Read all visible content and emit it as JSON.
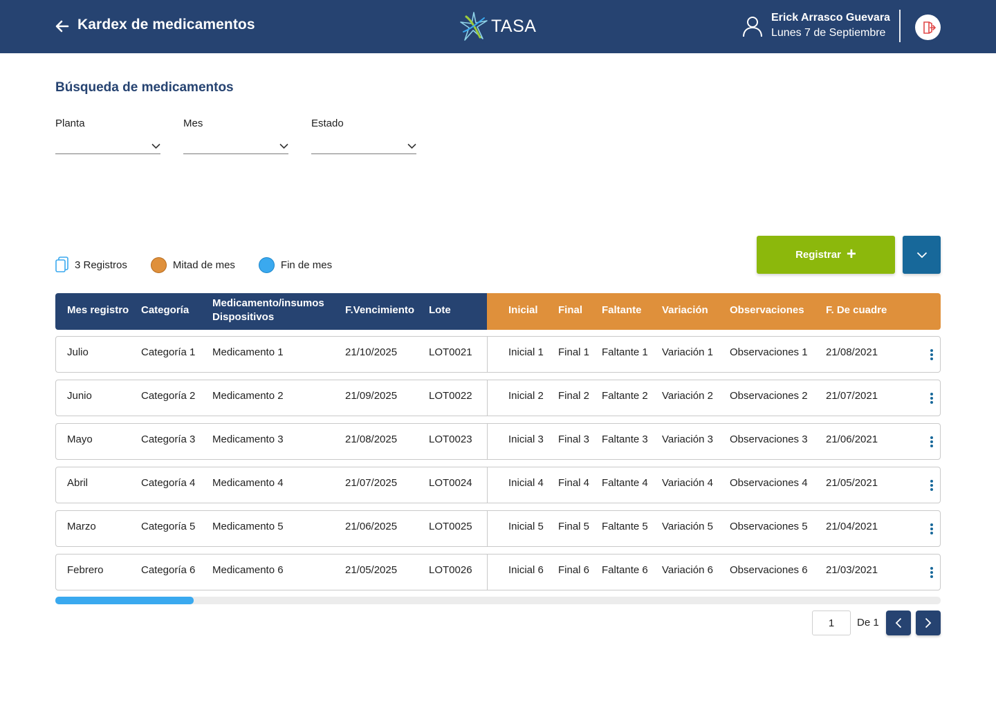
{
  "header": {
    "title": "Kardex de medicamentos",
    "brand": "TASA",
    "user_name": "Erick Arrasco Guevara",
    "date": "Lunes 7 de Septiembre",
    "colors": {
      "bar": "#264371",
      "logout_icon": "#e04848"
    }
  },
  "search": {
    "title": "Búsqueda de medicamentos",
    "filters": [
      {
        "label": "Planta",
        "value": ""
      },
      {
        "label": "Mes",
        "value": ""
      },
      {
        "label": "Estado",
        "value": ""
      }
    ]
  },
  "legend": {
    "records": "3 Registros",
    "mid_month": {
      "label": "Mitad de mes",
      "color": "#df903b"
    },
    "end_month": {
      "label": "Fin de mes",
      "color": "#3aa9ef"
    }
  },
  "actions": {
    "register_label": "Registrar",
    "register_color": "#8cb80c",
    "more_color": "#17689a"
  },
  "table": {
    "headers": {
      "mes": "Mes registro",
      "categoria": "Categoría",
      "medicamento_1": "Medicamento/insumos",
      "medicamento_2": "Dispositivos",
      "vencimiento": "F.Vencimiento",
      "lote": "Lote",
      "inicial": "Inicial",
      "final": "Final",
      "faltante": "Faltante",
      "variacion": "Variación",
      "observaciones": "Observaciones",
      "cuadre": "F. De cuadre"
    },
    "rows": [
      {
        "mes": "Julio",
        "categoria": "Categoría 1",
        "medicamento": "Medicamento 1",
        "vencimiento": "21/10/2025",
        "lote": "LOT0021",
        "inicial": "Inicial 1",
        "final": "Final 1",
        "faltante": "Faltante 1",
        "variacion": "Variación 1",
        "observaciones": "Observaciones 1",
        "cuadre": "21/08/2021"
      },
      {
        "mes": "Junio",
        "categoria": "Categoría 2",
        "medicamento": "Medicamento 2",
        "vencimiento": "21/09/2025",
        "lote": "LOT0022",
        "inicial": "Inicial 2",
        "final": "Final 2",
        "faltante": "Faltante 2",
        "variacion": "Variación 2",
        "observaciones": "Observaciones 2",
        "cuadre": "21/07/2021"
      },
      {
        "mes": "Mayo",
        "categoria": "Categoría 3",
        "medicamento": "Medicamento 3",
        "vencimiento": "21/08/2025",
        "lote": "LOT0023",
        "inicial": "Inicial 3",
        "final": "Final 3",
        "faltante": "Faltante 3",
        "variacion": "Variación 3",
        "observaciones": "Observaciones 3",
        "cuadre": "21/06/2021"
      },
      {
        "mes": "Abril",
        "categoria": "Categoría 4",
        "medicamento": "Medicamento 4",
        "vencimiento": "21/07/2025",
        "lote": "LOT0024",
        "inicial": "Inicial 4",
        "final": "Final 4",
        "faltante": "Faltante 4",
        "variacion": "Variación 4",
        "observaciones": "Observaciones 4",
        "cuadre": "21/05/2021"
      },
      {
        "mes": "Marzo",
        "categoria": "Categoría 5",
        "medicamento": "Medicamento 5",
        "vencimiento": "21/06/2025",
        "lote": "LOT0025",
        "inicial": "Inicial 5",
        "final": "Final 5",
        "faltante": "Faltante 5",
        "variacion": "Variación 5",
        "observaciones": "Observaciones 5",
        "cuadre": "21/04/2021"
      },
      {
        "mes": "Febrero",
        "categoria": "Categoría 6",
        "medicamento": "Medicamento 6",
        "vencimiento": "21/05/2025",
        "lote": "LOT0026",
        "inicial": "Inicial 6",
        "final": "Final 6",
        "faltante": "Faltante 6",
        "variacion": "Variación 6",
        "observaciones": "Observaciones 6",
        "cuadre": "21/03/2021"
      }
    ]
  },
  "pagination": {
    "current": "1",
    "of_label": "De 1"
  }
}
